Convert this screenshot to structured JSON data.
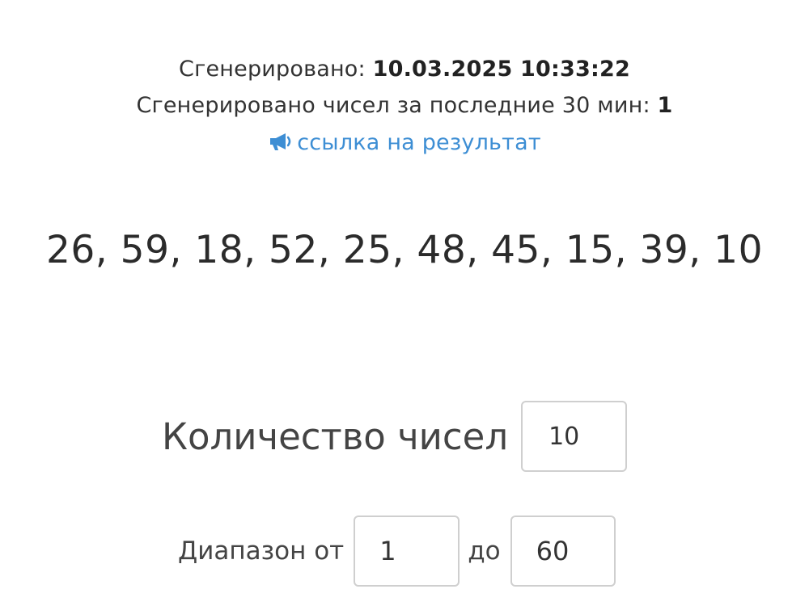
{
  "meta": {
    "generated_label": "Сгенерировано:",
    "generated_value": "10.03.2025 10:33:22",
    "count_label": "Сгенерировано чисел за последние 30 мин:",
    "count_value": "1",
    "link_text": "ссылка на результат",
    "link_icon": "megaphone-icon",
    "link_color": "#3d8ed4"
  },
  "result": {
    "numbers_text": "26, 59, 18, 52, 25, 48, 45, 15, 39, 10"
  },
  "form": {
    "quantity_label": "Количество чисел",
    "quantity_value": "10",
    "range_from_label": "Диапазон от",
    "range_from_value": "1",
    "range_to_label": "до",
    "range_to_value": "60"
  }
}
